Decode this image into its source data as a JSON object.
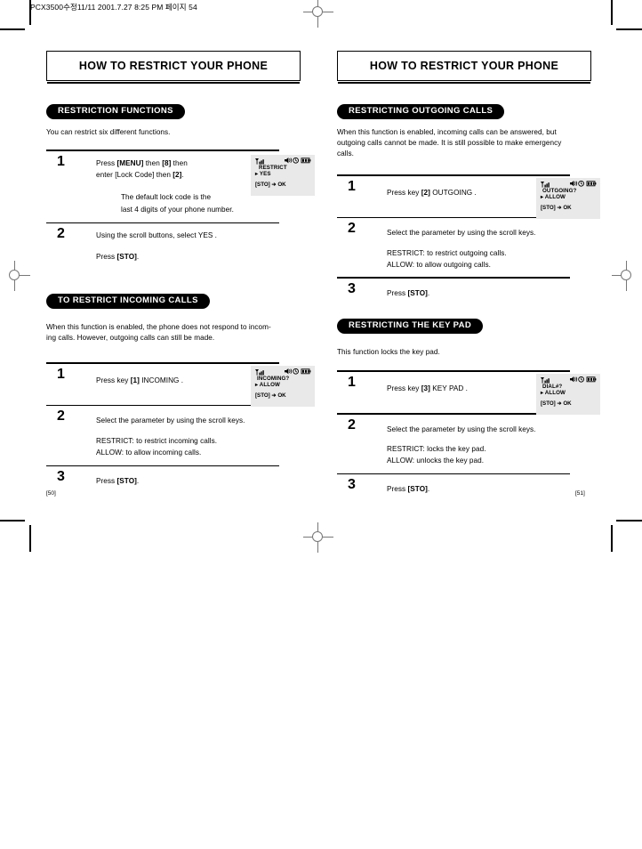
{
  "running_header": "PCX3500수정11/11  2001.7.27 8:25 PM 페이지 54",
  "left_page": {
    "title": "HOW TO RESTRICT YOUR PHONE",
    "page_number": "[50]",
    "sections": [
      {
        "heading": "RESTRICTION FUNCTIONS",
        "intro": "You can restrict six different functions.",
        "steps": [
          {
            "num": "1",
            "line1_a": "Press ",
            "line1_b": "[MENU]",
            "line1_c": " then ",
            "line1_d": "[8]",
            "line1_e": " then",
            "line2_a": "enter [Lock Code] then ",
            "line2_b": "[2]",
            "line2_c": ".",
            "sub1": "The default lock code is the",
            "sub2": "last 4 digits of your phone number.",
            "lcd": {
              "signal": "signal-bars-icon",
              "icons": "speaker-alarm-battery-icons",
              "line1": "RESTRICT",
              "line2": "▸  YES",
              "line3": "[STO] ➔ OK"
            }
          },
          {
            "num": "2",
            "line1": "Using the scroll buttons, select  YES .",
            "line2_a": "Press ",
            "line2_b": "[STO]",
            "line2_c": "."
          }
        ]
      },
      {
        "heading": "TO RESTRICT INCOMING CALLS",
        "intro": "When this function is enabled, the phone does not respond to incom-ing calls.  However, outgoing calls can still be made.",
        "steps": [
          {
            "num": "1",
            "line1_a": "Press key ",
            "line1_b": "[1]",
            "line1_c": "  INCOMING .",
            "lcd": {
              "signal": "signal-bars-icon",
              "icons": "speaker-alarm-battery-icons",
              "line1": "INCOMING?",
              "line2": "▸ ALLOW",
              "line3": "[STO] ➔ OK"
            }
          },
          {
            "num": "2",
            "line1": "Select the parameter by using the scroll keys.",
            "line2": "RESTRICT:  to restrict incoming calls.",
            "line3": "ALLOW:  to allow incoming calls."
          },
          {
            "num": "3",
            "line1_a": "Press ",
            "line1_b": "[STO]",
            "line1_c": "."
          }
        ]
      }
    ]
  },
  "right_page": {
    "title": "HOW TO RESTRICT YOUR PHONE",
    "page_number": "[51]",
    "sections": [
      {
        "heading": "RESTRICTING OUTGOING CALLS",
        "intro": "When this function is enabled, incoming calls can be answered, but outgoing calls cannot be made.  It is still possible to make emergency calls.",
        "steps": [
          {
            "num": "1",
            "line1_a": "Press key ",
            "line1_b": "[2]",
            "line1_c": "  OUTGOING .",
            "lcd": {
              "signal": "signal-bars-icon",
              "icons": "speaker-alarm-battery-icons",
              "line1": "OUTGOING?",
              "line2": "▸ ALLOW",
              "line3": "[STO] ➔ OK"
            }
          },
          {
            "num": "2",
            "line1": "Select the parameter by using the scroll keys.",
            "line2": "RESTRICT:  to restrict outgoing calls.",
            "line3": "ALLOW:  to allow outgoing calls."
          },
          {
            "num": "3",
            "line1_a": "Press ",
            "line1_b": "[STO]",
            "line1_c": "."
          }
        ]
      },
      {
        "heading": "RESTRICTING THE KEY PAD",
        "intro": "This function locks the key pad.",
        "steps": [
          {
            "num": "1",
            "line1_a": "Press key ",
            "line1_b": "[3]",
            "line1_c": "  KEY PAD .",
            "lcd": {
              "signal": "signal-bars-icon",
              "icons": "speaker-alarm-battery-icons",
              "line1": "DIAL#?",
              "line2": "▸ ALLOW",
              "line3": "[STO] ➔ OK"
            }
          },
          {
            "num": "2",
            "line1": "Select the parameter by using the scroll keys.",
            "line2": "RESTRICT:  locks the key pad.",
            "line3": "ALLOW:  unlocks the key pad."
          },
          {
            "num": "3",
            "line1_a": "Press ",
            "line1_b": "[STO]",
            "line1_c": "."
          }
        ]
      }
    ]
  }
}
